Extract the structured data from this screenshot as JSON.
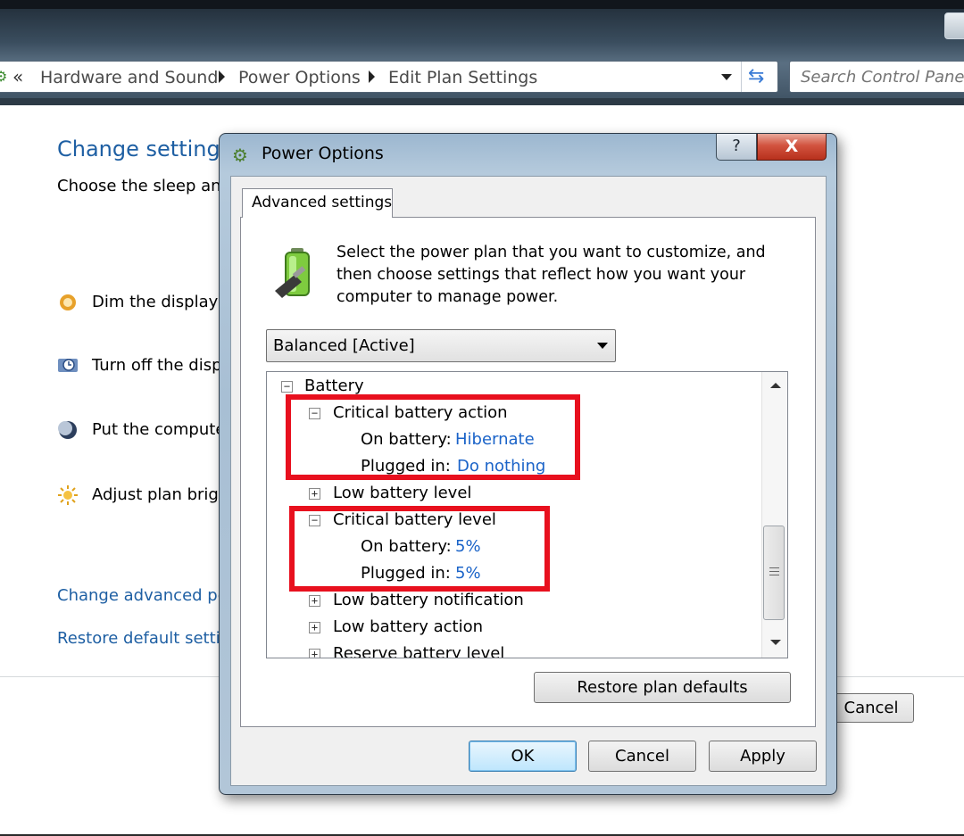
{
  "explorer": {
    "breadcrumb": [
      "Hardware and Sound",
      "Power Options",
      "Edit Plan Settings"
    ],
    "breadcrumb_prefix": "«",
    "search_placeholder": "Search Control Panel"
  },
  "page": {
    "title": "Change settings",
    "subtitle": "Choose the sleep and",
    "rows": [
      {
        "label": "Dim the display:",
        "icon": "dim-display-icon"
      },
      {
        "label": "Turn off the disp",
        "icon": "monitor-clock-icon"
      },
      {
        "label": "Put the compute",
        "icon": "moon-sleep-icon"
      },
      {
        "label": "Adjust plan brig",
        "icon": "sun-brightness-icon"
      }
    ],
    "links": [
      "Change advanced po",
      "Restore default settin"
    ],
    "cancel_label": "Cancel"
  },
  "dialog": {
    "title": "Power Options",
    "help_label": "?",
    "close_label": "X",
    "tab_label": "Advanced settings",
    "intro": "Select the power plan that you want to customize, and then choose settings that reflect how you want your computer to manage power.",
    "plan_selected": "Balanced [Active]",
    "tree": {
      "battery": "Battery",
      "critical_action": {
        "label": "Critical battery action",
        "on_battery_label": "On battery:",
        "on_battery_value": "Hibernate",
        "plugged_in_label": "Plugged in:",
        "plugged_in_value": "Do nothing"
      },
      "low_level": "Low battery level",
      "critical_level": {
        "label": "Critical battery level",
        "on_battery_label": "On battery:",
        "on_battery_value": "5%",
        "plugged_in_label": "Plugged in:",
        "plugged_in_value": "5%"
      },
      "low_notification": "Low battery notification",
      "low_action": "Low battery action",
      "reserve_level": "Reserve battery level"
    },
    "restore_label": "Restore plan defaults",
    "ok_label": "OK",
    "cancel_label": "Cancel",
    "apply_label": "Apply",
    "highlight_color": "#e8101e",
    "value_color": "#1a63c8"
  }
}
